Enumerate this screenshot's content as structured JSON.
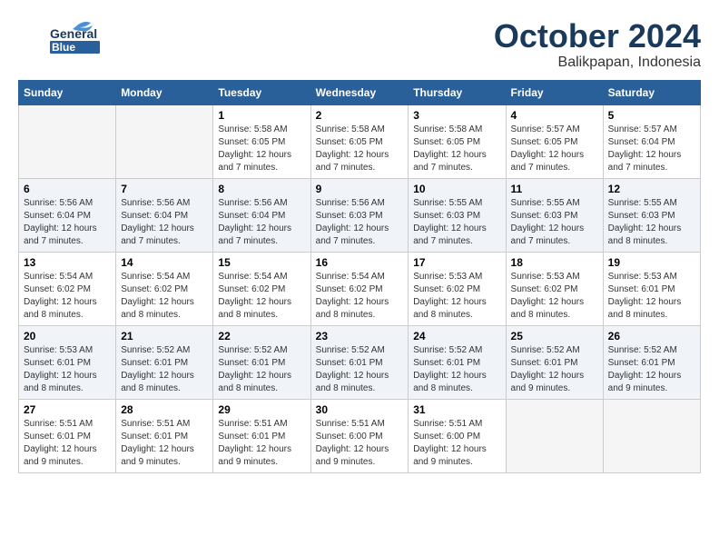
{
  "logo": {
    "line1": "General",
    "line2": "Blue"
  },
  "header": {
    "month": "October 2024",
    "location": "Balikpapan, Indonesia"
  },
  "weekdays": [
    "Sunday",
    "Monday",
    "Tuesday",
    "Wednesday",
    "Thursday",
    "Friday",
    "Saturday"
  ],
  "weeks": [
    [
      {
        "day": "",
        "info": ""
      },
      {
        "day": "",
        "info": ""
      },
      {
        "day": "1",
        "info": "Sunrise: 5:58 AM\nSunset: 6:05 PM\nDaylight: 12 hours\nand 7 minutes."
      },
      {
        "day": "2",
        "info": "Sunrise: 5:58 AM\nSunset: 6:05 PM\nDaylight: 12 hours\nand 7 minutes."
      },
      {
        "day": "3",
        "info": "Sunrise: 5:58 AM\nSunset: 6:05 PM\nDaylight: 12 hours\nand 7 minutes."
      },
      {
        "day": "4",
        "info": "Sunrise: 5:57 AM\nSunset: 6:05 PM\nDaylight: 12 hours\nand 7 minutes."
      },
      {
        "day": "5",
        "info": "Sunrise: 5:57 AM\nSunset: 6:04 PM\nDaylight: 12 hours\nand 7 minutes."
      }
    ],
    [
      {
        "day": "6",
        "info": "Sunrise: 5:56 AM\nSunset: 6:04 PM\nDaylight: 12 hours\nand 7 minutes."
      },
      {
        "day": "7",
        "info": "Sunrise: 5:56 AM\nSunset: 6:04 PM\nDaylight: 12 hours\nand 7 minutes."
      },
      {
        "day": "8",
        "info": "Sunrise: 5:56 AM\nSunset: 6:04 PM\nDaylight: 12 hours\nand 7 minutes."
      },
      {
        "day": "9",
        "info": "Sunrise: 5:56 AM\nSunset: 6:03 PM\nDaylight: 12 hours\nand 7 minutes."
      },
      {
        "day": "10",
        "info": "Sunrise: 5:55 AM\nSunset: 6:03 PM\nDaylight: 12 hours\nand 7 minutes."
      },
      {
        "day": "11",
        "info": "Sunrise: 5:55 AM\nSunset: 6:03 PM\nDaylight: 12 hours\nand 7 minutes."
      },
      {
        "day": "12",
        "info": "Sunrise: 5:55 AM\nSunset: 6:03 PM\nDaylight: 12 hours\nand 8 minutes."
      }
    ],
    [
      {
        "day": "13",
        "info": "Sunrise: 5:54 AM\nSunset: 6:02 PM\nDaylight: 12 hours\nand 8 minutes."
      },
      {
        "day": "14",
        "info": "Sunrise: 5:54 AM\nSunset: 6:02 PM\nDaylight: 12 hours\nand 8 minutes."
      },
      {
        "day": "15",
        "info": "Sunrise: 5:54 AM\nSunset: 6:02 PM\nDaylight: 12 hours\nand 8 minutes."
      },
      {
        "day": "16",
        "info": "Sunrise: 5:54 AM\nSunset: 6:02 PM\nDaylight: 12 hours\nand 8 minutes."
      },
      {
        "day": "17",
        "info": "Sunrise: 5:53 AM\nSunset: 6:02 PM\nDaylight: 12 hours\nand 8 minutes."
      },
      {
        "day": "18",
        "info": "Sunrise: 5:53 AM\nSunset: 6:02 PM\nDaylight: 12 hours\nand 8 minutes."
      },
      {
        "day": "19",
        "info": "Sunrise: 5:53 AM\nSunset: 6:01 PM\nDaylight: 12 hours\nand 8 minutes."
      }
    ],
    [
      {
        "day": "20",
        "info": "Sunrise: 5:53 AM\nSunset: 6:01 PM\nDaylight: 12 hours\nand 8 minutes."
      },
      {
        "day": "21",
        "info": "Sunrise: 5:52 AM\nSunset: 6:01 PM\nDaylight: 12 hours\nand 8 minutes."
      },
      {
        "day": "22",
        "info": "Sunrise: 5:52 AM\nSunset: 6:01 PM\nDaylight: 12 hours\nand 8 minutes."
      },
      {
        "day": "23",
        "info": "Sunrise: 5:52 AM\nSunset: 6:01 PM\nDaylight: 12 hours\nand 8 minutes."
      },
      {
        "day": "24",
        "info": "Sunrise: 5:52 AM\nSunset: 6:01 PM\nDaylight: 12 hours\nand 8 minutes."
      },
      {
        "day": "25",
        "info": "Sunrise: 5:52 AM\nSunset: 6:01 PM\nDaylight: 12 hours\nand 9 minutes."
      },
      {
        "day": "26",
        "info": "Sunrise: 5:52 AM\nSunset: 6:01 PM\nDaylight: 12 hours\nand 9 minutes."
      }
    ],
    [
      {
        "day": "27",
        "info": "Sunrise: 5:51 AM\nSunset: 6:01 PM\nDaylight: 12 hours\nand 9 minutes."
      },
      {
        "day": "28",
        "info": "Sunrise: 5:51 AM\nSunset: 6:01 PM\nDaylight: 12 hours\nand 9 minutes."
      },
      {
        "day": "29",
        "info": "Sunrise: 5:51 AM\nSunset: 6:01 PM\nDaylight: 12 hours\nand 9 minutes."
      },
      {
        "day": "30",
        "info": "Sunrise: 5:51 AM\nSunset: 6:00 PM\nDaylight: 12 hours\nand 9 minutes."
      },
      {
        "day": "31",
        "info": "Sunrise: 5:51 AM\nSunset: 6:00 PM\nDaylight: 12 hours\nand 9 minutes."
      },
      {
        "day": "",
        "info": ""
      },
      {
        "day": "",
        "info": ""
      }
    ]
  ]
}
